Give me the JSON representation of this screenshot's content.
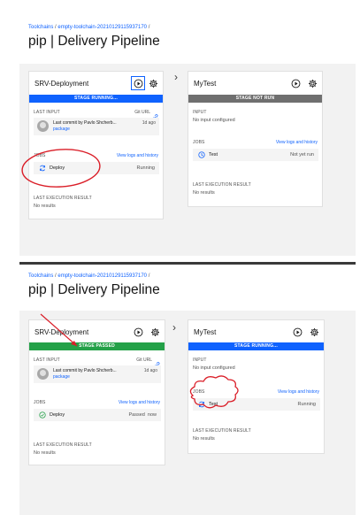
{
  "top": {
    "breadcrumb": {
      "parent": "Toolchains",
      "child": "empty-toolchain-20210129115937170",
      "sep": "/"
    },
    "title": "pip | Delivery Pipeline",
    "stage1": {
      "name": "SRV-Deployment",
      "status": "STAGE RUNNING...",
      "last_input_label": "LAST INPUT",
      "git_url_label": "Git URL",
      "commit_text": "Last commit by Pavlo Shcherb...",
      "commit_age": "1d ago",
      "commit_link": "package",
      "jobs_label": "JOBS",
      "view_logs": "View logs and history",
      "job_name": "Deploy",
      "job_status": "Running",
      "last_result_label": "LAST EXECUTION RESULT",
      "last_result": "No results"
    },
    "stage2": {
      "name": "MyTest",
      "status": "STAGE NOT RUN",
      "input_label": "INPUT",
      "input_value": "No input configured",
      "jobs_label": "JOBS",
      "view_logs": "View logs and history",
      "job_name": "Test",
      "job_status": "Not yet run",
      "last_result_label": "LAST EXECUTION RESULT",
      "last_result": "No results"
    }
  },
  "bottom": {
    "breadcrumb": {
      "parent": "Toolchains",
      "child": "empty-toolchain-20210129115937170",
      "sep": "/"
    },
    "title": "pip | Delivery Pipeline",
    "stage1": {
      "name": "SRV-Deployment",
      "status": "STAGE PASSED",
      "last_input_label": "LAST INPUT",
      "git_url_label": "Git URL",
      "commit_text": "Last commit by Pavlo Shcherb...",
      "commit_age": "1d ago",
      "commit_link": "package",
      "jobs_label": "JOBS",
      "view_logs": "View logs and history",
      "job_name": "Deploy",
      "job_status": "Passed",
      "job_age": "now",
      "last_result_label": "LAST EXECUTION RESULT",
      "last_result": "No results"
    },
    "stage2": {
      "name": "MyTest",
      "status": "STAGE RUNNING...",
      "input_label": "INPUT",
      "input_value": "No input configured",
      "jobs_label": "JOBS",
      "view_logs": "View logs and history",
      "job_name": "Test",
      "job_status": "Running",
      "last_result_label": "LAST EXECUTION RESULT",
      "last_result": "No results"
    }
  },
  "colors": {
    "link": "#0f62fe",
    "running": "#0f62fe",
    "not_run": "#6f6f6f",
    "passed": "#24a148",
    "annotation": "#da1e28"
  },
  "icons": [
    "play-icon",
    "settings-icon",
    "link-icon",
    "sync-icon",
    "clock-icon",
    "check-circle-icon",
    "chevron-right-icon"
  ]
}
